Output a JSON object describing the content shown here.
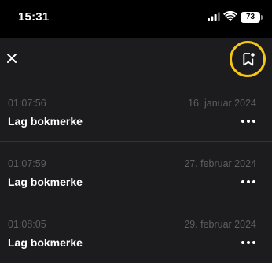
{
  "status_bar": {
    "time": "15:31",
    "battery": "73",
    "icons": [
      "signal-icon",
      "wifi-icon",
      "battery-icon"
    ]
  },
  "toolbar": {
    "close_icon": "close-icon",
    "add_bookmark_icon": "bookmark-add-icon",
    "highlight_color": "#f5c518"
  },
  "bookmarks": [
    {
      "time": "01:07:56",
      "date": "16. januar 2024",
      "title": "Lag bokmerke"
    },
    {
      "time": "01:07:59",
      "date": "27. februar 2024",
      "title": "Lag bokmerke"
    },
    {
      "time": "01:08:05",
      "date": "29. februar 2024",
      "title": "Lag bokmerke"
    }
  ]
}
